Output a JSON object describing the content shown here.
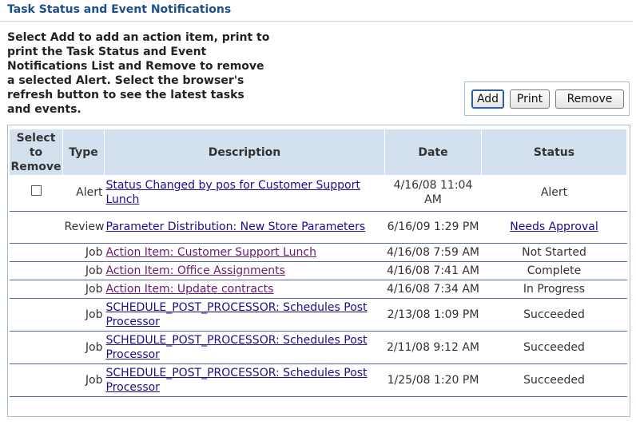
{
  "header": {
    "title": "Task Status and Event Notifications"
  },
  "instructions": "Select Add to add an action item, print to print the Task Status and Event Notifications List and Remove to remove a selected Alert. Select the browser's refresh button to see the latest tasks and events.",
  "toolbar": {
    "add_label": "Add",
    "print_label": "Print",
    "remove_label": "Remove"
  },
  "table": {
    "columns": {
      "select": "Select to Remove",
      "type": "Type",
      "description": "Description",
      "date": "Date",
      "status": "Status"
    },
    "rows": [
      {
        "has_checkbox": true,
        "type": "Alert",
        "description": "Status Changed by pos for Customer Support Lunch",
        "date": "4/16/08 11:04 AM",
        "status": "Alert"
      },
      {
        "has_checkbox": false,
        "type": "Review",
        "description": "Parameter Distribution: New Store Parameters",
        "date": "6/16/09 1:29 PM",
        "status": "Needs Approval"
      },
      {
        "has_checkbox": false,
        "type": "Job",
        "description": "Action Item: Customer Support Lunch",
        "date": "4/16/08 7:59 AM",
        "status": "Not Started"
      },
      {
        "has_checkbox": false,
        "type": "Job",
        "description": "Action Item: Office Assignments",
        "date": "4/16/08 7:41 AM",
        "status": "Complete"
      },
      {
        "has_checkbox": false,
        "type": "Job",
        "description": "Action Item: Update contracts",
        "date": "4/16/08 7:34 AM",
        "status": "In Progress"
      },
      {
        "has_checkbox": false,
        "type": "Job",
        "description": "SCHEDULE_POST_PROCESSOR: Schedules Post Processor",
        "date": "2/13/08 1:09 PM",
        "status": "Succeeded"
      },
      {
        "has_checkbox": false,
        "type": "Job",
        "description": "SCHEDULE_POST_PROCESSOR: Schedules Post Processor",
        "date": "2/11/08 9:12 AM",
        "status": "Succeeded"
      },
      {
        "has_checkbox": false,
        "type": "Job",
        "description": "SCHEDULE_POST_PROCESSOR: Schedules Post Processor",
        "date": "1/25/08 1:20 PM",
        "status": "Succeeded"
      }
    ]
  },
  "colors": {
    "title": "#1c4f8e",
    "header_bg": "#d3e1ee",
    "frame_border": "#a6c0d8",
    "row_divider": "#5468a8",
    "link": "#1a0e8c",
    "visited_link": "#6a1a72"
  }
}
